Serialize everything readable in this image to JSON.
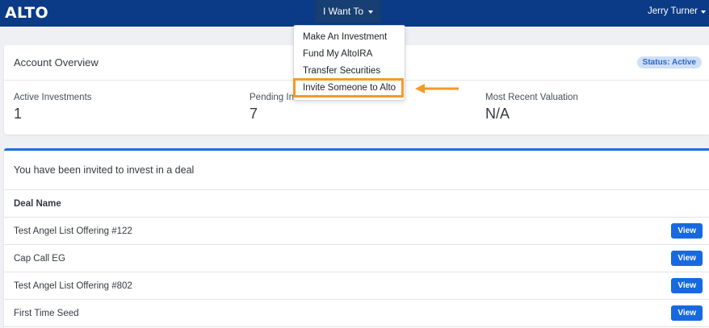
{
  "brand": {
    "logo": "ALTO"
  },
  "navbar": {
    "want_label": "I Want To",
    "user_name": "Jerry Turner"
  },
  "dropdown": {
    "items": [
      {
        "label": "Make An Investment"
      },
      {
        "label": "Fund My AltoIRA"
      },
      {
        "label": "Transfer Securities"
      },
      {
        "label": "Invite Someone to Alto"
      }
    ]
  },
  "account_overview": {
    "title": "Account Overview",
    "status_badge": "Status: Active",
    "stats": [
      {
        "label": "Active Investments",
        "value": "1"
      },
      {
        "label": "Pending In",
        "value": "7"
      },
      {
        "label": "Most Recent Valuation",
        "value": "N/A"
      }
    ]
  },
  "invitations": {
    "title": "You have been invited to invest in a deal",
    "column_header": "Deal Name",
    "view_label": "View",
    "rows": [
      {
        "name": "Test Angel List Offering #122"
      },
      {
        "name": "Cap Call EG"
      },
      {
        "name": "Test Angel List Offering #802"
      },
      {
        "name": "First Time Seed"
      }
    ]
  },
  "colors": {
    "navbar": "#0b3a86",
    "accent": "#1769e0",
    "highlight": "#f39a2b",
    "status_badge_bg": "#cfdff8"
  }
}
